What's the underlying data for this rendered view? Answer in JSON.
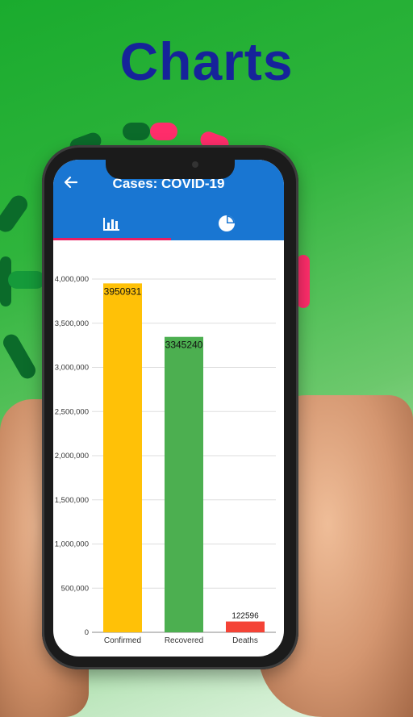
{
  "headline": "Charts",
  "app": {
    "title": "Cases: COVID-19",
    "back_icon": "arrow-back-icon",
    "tabs": [
      {
        "icon": "bar-chart-icon",
        "selected": true
      },
      {
        "icon": "pie-chart-icon",
        "selected": false
      }
    ],
    "colors": {
      "appbar": "#1976d2",
      "indicator": "#e91e63"
    }
  },
  "chart_data": {
    "type": "bar",
    "categories": [
      "Confirmed",
      "Recovered",
      "Deaths"
    ],
    "values": [
      3950931,
      3345240,
      122596
    ],
    "value_labels": [
      "3950931",
      "3345240",
      "122596"
    ],
    "colors": [
      "#ffc107",
      "#4caf50",
      "#f44336"
    ],
    "ylim": [
      0,
      4000000
    ],
    "yticks": [
      0,
      500000,
      1000000,
      1500000,
      2000000,
      2500000,
      3000000,
      3500000,
      4000000
    ],
    "ytick_labels": [
      "0",
      "500,000",
      "1,000,000",
      "1,500,000",
      "2,000,000",
      "2,500,000",
      "3,000,000",
      "3,500,000",
      "4,000,000"
    ],
    "grid": true
  }
}
